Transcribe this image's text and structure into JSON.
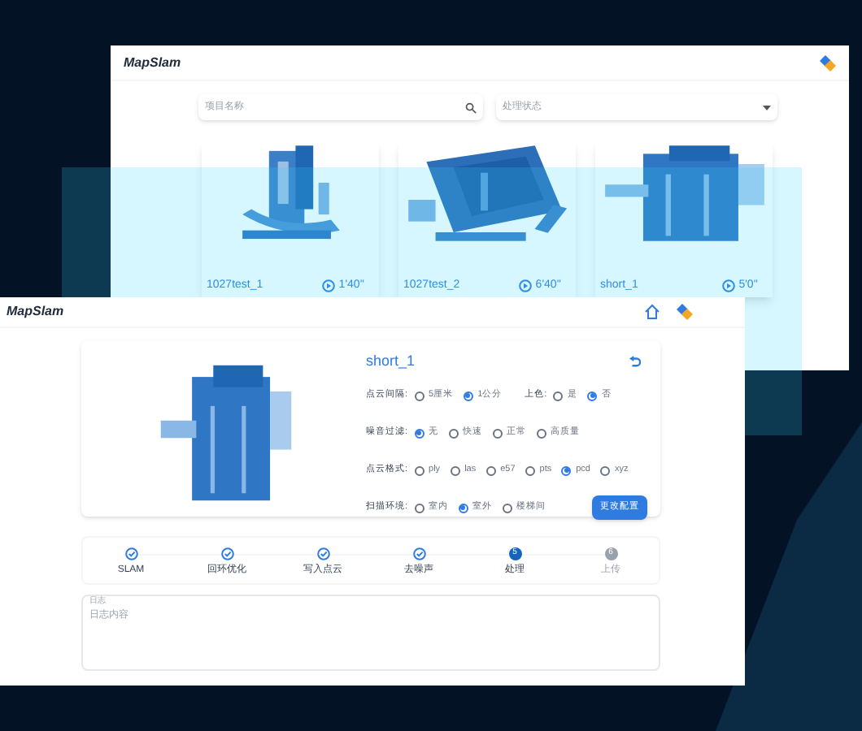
{
  "back_window": {
    "title": "MapSlam",
    "search": {
      "placeholder": "项目名称"
    },
    "status_select": {
      "placeholder": "处理状态"
    },
    "cards": [
      {
        "name": "1027test_1",
        "duration": "1'40''"
      },
      {
        "name": "1027test_2",
        "duration": "6'40''"
      },
      {
        "name": "short_1",
        "duration": "5'0''"
      }
    ]
  },
  "front_window": {
    "title": "MapSlam",
    "detail": {
      "name": "short_1",
      "options": [
        {
          "groups": [
            {
              "label": "点云间隔:",
              "choices": [
                {
                  "label": "5厘米",
                  "selected": false
                },
                {
                  "label": "1公分",
                  "selected": true
                }
              ]
            },
            {
              "label": "上色:",
              "choices": [
                {
                  "label": "是",
                  "selected": false
                },
                {
                  "label": "否",
                  "selected": true
                }
              ]
            }
          ]
        },
        {
          "groups": [
            {
              "label": "噪音过滤:",
              "choices": [
                {
                  "label": "无",
                  "selected": true
                },
                {
                  "label": "快速",
                  "selected": false
                },
                {
                  "label": "正常",
                  "selected": false
                },
                {
                  "label": "高质量",
                  "selected": false
                }
              ]
            }
          ]
        },
        {
          "groups": [
            {
              "label": "点云格式:",
              "choices": [
                {
                  "label": "ply",
                  "selected": false
                },
                {
                  "label": "las",
                  "selected": false
                },
                {
                  "label": "e57",
                  "selected": false
                },
                {
                  "label": "pts",
                  "selected": false
                },
                {
                  "label": "pcd",
                  "selected": true
                },
                {
                  "label": "xyz",
                  "selected": false
                }
              ]
            }
          ]
        },
        {
          "groups": [
            {
              "label": "扫描环境:",
              "choices": [
                {
                  "label": "室内",
                  "selected": false
                },
                {
                  "label": "室外",
                  "selected": true
                },
                {
                  "label": "楼梯间",
                  "selected": false
                }
              ]
            }
          ]
        }
      ],
      "button": "更改配置"
    },
    "steps": [
      {
        "label": "SLAM",
        "completed": true
      },
      {
        "label": "回环优化",
        "completed": true
      },
      {
        "label": "写入点云",
        "completed": true
      },
      {
        "label": "去噪声",
        "completed": true
      },
      {
        "label": "处理",
        "number": "5",
        "completed": false,
        "current": true
      },
      {
        "label": "上传",
        "number": "6",
        "completed": false,
        "current": false
      }
    ],
    "log": {
      "label": "日志",
      "placeholder": "日志内容"
    }
  }
}
